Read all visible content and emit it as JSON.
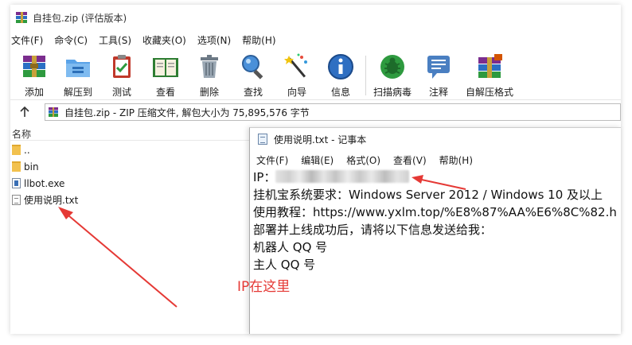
{
  "window": {
    "title": "自挂包.zip (评估版本)"
  },
  "menu": [
    "文件(F)",
    "命令(C)",
    "工具(S)",
    "收藏夹(O)",
    "选项(N)",
    "帮助(H)"
  ],
  "toolbar": {
    "items": [
      {
        "label": "添加",
        "icon": "add-archive-icon"
      },
      {
        "label": "解压到",
        "icon": "extract-to-icon"
      },
      {
        "label": "测试",
        "icon": "test-icon"
      },
      {
        "label": "查看",
        "icon": "view-book-icon"
      },
      {
        "label": "删除",
        "icon": "trash-icon"
      },
      {
        "label": "查找",
        "icon": "magnifier-icon"
      },
      {
        "label": "向导",
        "icon": "wizard-wand-icon"
      },
      {
        "label": "信息",
        "icon": "info-icon"
      },
      {
        "label": "扫描病毒",
        "icon": "virus-scan-icon"
      },
      {
        "label": "注释",
        "icon": "comment-icon"
      },
      {
        "label": "自解压格式",
        "icon": "sfx-archive-icon"
      }
    ]
  },
  "address": {
    "text": "自挂包.zip - ZIP 压缩文件, 解包大小为 75,895,576 字节"
  },
  "columns": {
    "name": "名称"
  },
  "files": [
    {
      "name": "..",
      "type": "folder"
    },
    {
      "name": "bin",
      "type": "folder"
    },
    {
      "name": "llbot.exe",
      "type": "exe"
    },
    {
      "name": "使用说明.txt",
      "type": "txt"
    }
  ],
  "notepad": {
    "title": "使用说明.txt - 记事本",
    "menu": [
      "文件(F)",
      "编辑(E)",
      "格式(O)",
      "查看(V)",
      "帮助(H)"
    ],
    "lines": {
      "ip_label": "IP：",
      "line2": "挂机宝系统要求：Windows Server 2012 / Windows 10 及以上",
      "line3": "使用教程：https://www.yxlm.top/%E8%87%AA%E6%8C%82.h",
      "line4": "部署并上线成功后，请将以下信息发送给我：",
      "line5": "机器人 QQ 号",
      "line6": "主人 QQ 号"
    }
  },
  "annotation": {
    "text": "IP在这里",
    "color": "#e53935"
  }
}
